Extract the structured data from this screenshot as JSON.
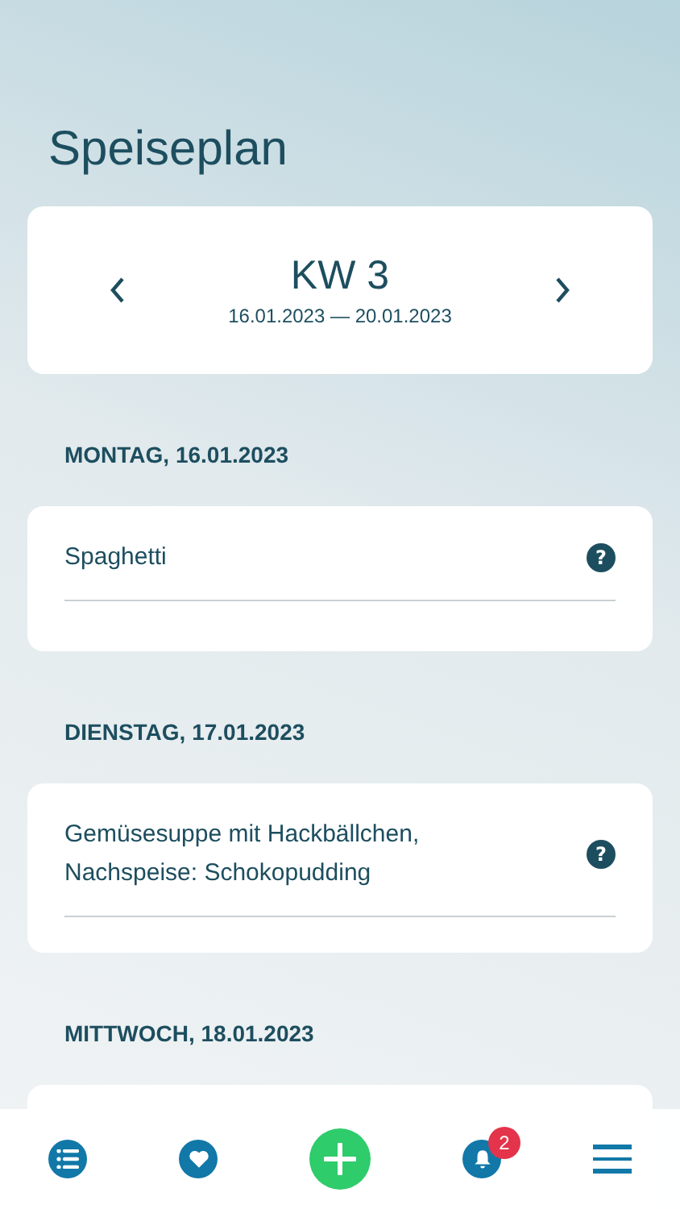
{
  "title": "Speiseplan",
  "week": {
    "label": "KW 3",
    "range": "16.01.2023 — 20.01.2023"
  },
  "days": [
    {
      "heading": "MONTAG, 16.01.2023",
      "meal": [
        "Spaghetti"
      ],
      "help": "?"
    },
    {
      "heading": "DIENSTAG, 17.01.2023",
      "meal": [
        "Gemüsesuppe mit Hackbällchen,",
        "Nachspeise: Schokopudding"
      ],
      "help": "?"
    },
    {
      "heading": "MITTWOCH, 18.01.2023"
    }
  ],
  "nav": {
    "notifications": "2"
  }
}
